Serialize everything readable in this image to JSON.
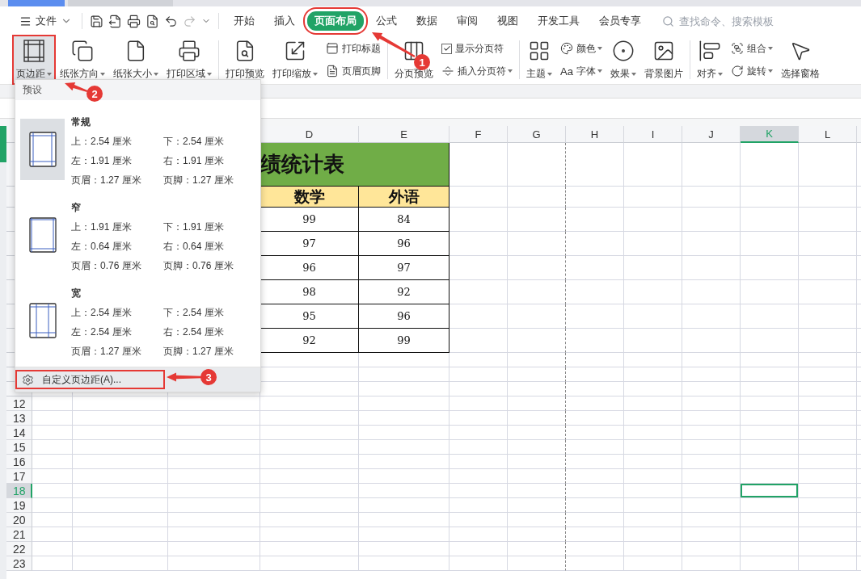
{
  "menu": {
    "file": "文件"
  },
  "quick_access": [
    {
      "kind": "save",
      "disabled": false
    },
    {
      "kind": "export",
      "disabled": false
    },
    {
      "kind": "print",
      "disabled": false
    },
    {
      "kind": "preview",
      "disabled": false
    },
    {
      "kind": "undo",
      "disabled": false
    },
    {
      "kind": "redo",
      "disabled": true
    },
    {
      "kind": "more",
      "disabled": false
    }
  ],
  "tabs": [
    {
      "label": "开始",
      "selected": false,
      "annotated": false
    },
    {
      "label": "插入",
      "selected": false,
      "annotated": false
    },
    {
      "label": "页面布局",
      "selected": true,
      "annotated": true
    },
    {
      "label": "公式",
      "selected": false,
      "annotated": false
    },
    {
      "label": "数据",
      "selected": false,
      "annotated": false
    },
    {
      "label": "审阅",
      "selected": false,
      "annotated": false
    },
    {
      "label": "视图",
      "selected": false,
      "annotated": false
    },
    {
      "label": "开发工具",
      "selected": false,
      "annotated": false
    },
    {
      "label": "会员专享",
      "selected": false,
      "annotated": false
    }
  ],
  "search": {
    "placeholder": "查找命令、搜索模板"
  },
  "ribbon": [
    {
      "items": [
        {
          "kind": "large",
          "label": "页边距",
          "dropdown": true,
          "pressed": true,
          "annotated": true
        },
        {
          "kind": "large",
          "label": "纸张方向",
          "dropdown": true,
          "pressed": false,
          "annotated": false
        },
        {
          "kind": "large",
          "label": "纸张大小",
          "dropdown": true,
          "pressed": false,
          "annotated": false
        },
        {
          "kind": "large",
          "label": "打印区域",
          "dropdown": true,
          "pressed": false,
          "annotated": false
        }
      ]
    },
    {
      "items": [
        {
          "kind": "large",
          "label": "打印预览",
          "dropdown": false,
          "pressed": false,
          "annotated": false
        },
        {
          "kind": "large",
          "label": "打印缩放",
          "dropdown": true,
          "pressed": false,
          "annotated": false
        },
        {
          "kind": "stack",
          "items": [
            {
              "kind": "small",
              "label": "打印标题",
              "dropdown": false
            },
            {
              "kind": "small",
              "label": "页眉页脚",
              "dropdown": false
            }
          ]
        }
      ]
    },
    {
      "items": [
        {
          "kind": "large",
          "label": "分页预览",
          "dropdown": false,
          "pressed": false,
          "annotated": false
        },
        {
          "kind": "stack",
          "items": [
            {
              "kind": "check",
              "label": "显示分页符",
              "checked": true
            },
            {
              "kind": "small",
              "label": "插入分页符",
              "dropdown": true
            }
          ]
        }
      ]
    },
    {
      "items": [
        {
          "kind": "large",
          "label": "主题",
          "dropdown": true,
          "pressed": false,
          "annotated": false
        },
        {
          "kind": "stack",
          "items": [
            {
              "kind": "small",
              "label": "颜色",
              "dropdown": true
            },
            {
              "kind": "glyph",
              "glyph": "Aa",
              "label": "字体",
              "dropdown": true
            }
          ]
        },
        {
          "kind": "large",
          "label": "效果",
          "dropdown": true,
          "pressed": false,
          "annotated": false
        },
        {
          "kind": "large",
          "label": "背景图片",
          "dropdown": false,
          "pressed": false,
          "annotated": false
        }
      ]
    },
    {
      "items": [
        {
          "kind": "large",
          "label": "对齐",
          "dropdown": true,
          "pressed": false,
          "annotated": false
        },
        {
          "kind": "stack",
          "items": [
            {
              "kind": "small",
              "label": "组合",
              "dropdown": true
            },
            {
              "kind": "small",
              "label": "旋转",
              "dropdown": true
            }
          ]
        },
        {
          "kind": "large",
          "label": "选择窗格",
          "dropdown": false,
          "pressed": false,
          "annotated": false
        }
      ]
    }
  ],
  "margins_menu": {
    "header": "预设",
    "presets": [
      {
        "kind": "normal",
        "name": "常规",
        "selected": true,
        "values": [
          "上：2.54 厘米",
          "下：2.54 厘米",
          "左：1.91 厘米",
          "右：1.91 厘米",
          "页眉：1.27 厘米",
          "页脚：1.27 厘米"
        ]
      },
      {
        "kind": "narrow",
        "name": "窄",
        "selected": false,
        "values": [
          "上：1.91 厘米",
          "下：1.91 厘米",
          "左：0.64 厘米",
          "右：0.64 厘米",
          "页眉：0.76 厘米",
          "页脚：0.76 厘米"
        ]
      },
      {
        "kind": "wide",
        "name": "宽",
        "selected": false,
        "values": [
          "上：2.54 厘米",
          "下：2.54 厘米",
          "左：2.54 厘米",
          "右：2.54 厘米",
          "页眉：1.27 厘米",
          "页脚：1.27 厘米"
        ]
      }
    ],
    "custom": {
      "label": "自定义页边距(A)...",
      "annotated": true
    }
  },
  "sheet": {
    "columns": [
      {
        "label": "D",
        "selected": false,
        "page_break": false
      },
      {
        "label": "E",
        "selected": false,
        "page_break": false
      },
      {
        "label": "F",
        "selected": false,
        "page_break": false
      },
      {
        "label": "G",
        "selected": false,
        "page_break": true
      },
      {
        "label": "H",
        "selected": false,
        "page_break": false
      },
      {
        "label": "I",
        "selected": false,
        "page_break": false
      },
      {
        "label": "J",
        "selected": false,
        "page_break": false
      },
      {
        "label": "K",
        "selected": true,
        "page_break": false
      },
      {
        "label": "L",
        "selected": false,
        "page_break": false
      }
    ],
    "rows": [
      {
        "label": "12",
        "selected": false
      },
      {
        "label": "13",
        "selected": false
      },
      {
        "label": "14",
        "selected": false
      },
      {
        "label": "15",
        "selected": false
      },
      {
        "label": "16",
        "selected": false
      },
      {
        "label": "17",
        "selected": false
      },
      {
        "label": "18",
        "selected": true
      },
      {
        "label": "19",
        "selected": false
      },
      {
        "label": "20",
        "selected": false
      },
      {
        "label": "21",
        "selected": false
      },
      {
        "label": "22",
        "selected": false
      },
      {
        "label": "23",
        "selected": false
      }
    ],
    "title": "绩统计表",
    "headers": [
      "数学",
      "外语"
    ],
    "data": [
      [
        "99",
        "84"
      ],
      [
        "97",
        "96"
      ],
      [
        "96",
        "97"
      ],
      [
        "98",
        "92"
      ],
      [
        "95",
        "96"
      ],
      [
        "92",
        "99"
      ]
    ]
  },
  "annotations": [
    {
      "number": "1"
    },
    {
      "number": "2"
    },
    {
      "number": "3"
    }
  ]
}
